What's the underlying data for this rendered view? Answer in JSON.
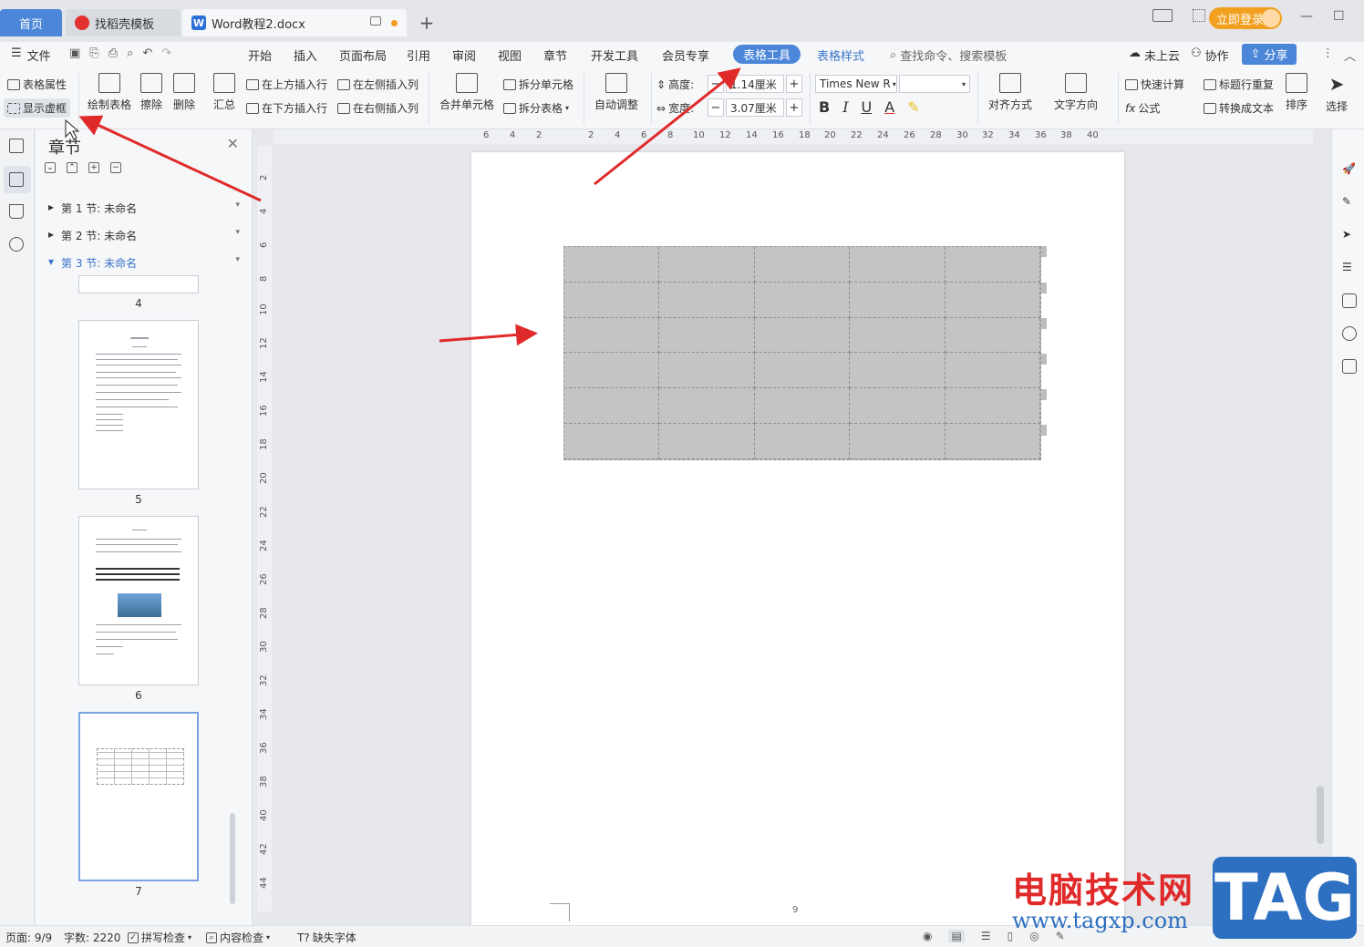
{
  "tabs": {
    "home": "首页",
    "daoke": "找稻壳模板",
    "doc": "Word教程2.docx"
  },
  "titlebar": {
    "login": "立即登录"
  },
  "menu": {
    "file": "文件",
    "items": [
      "开始",
      "插入",
      "页面布局",
      "引用",
      "审阅",
      "视图",
      "章节",
      "开发工具",
      "会员专享"
    ],
    "active": "表格工具",
    "table_style": "表格样式",
    "search": "查找命令、搜索模板",
    "cloud": "未上云",
    "collab": "协作",
    "share": "分享"
  },
  "ribbon": {
    "table_props": "表格属性",
    "show_grid": "显示虚框",
    "draw_table": "绘制表格",
    "erase": "擦除",
    "delete": "删除",
    "summary": "汇总",
    "insert_above": "在上方插入行",
    "insert_below": "在下方插入行",
    "insert_left": "在左侧插入列",
    "insert_right": "在右侧插入列",
    "merge_cells": "合并单元格",
    "split_cells": "拆分单元格",
    "split_table": "拆分表格",
    "auto_fit": "自动调整",
    "height_label": "高度:",
    "height_value": "1.14厘米",
    "width_label": "宽度:",
    "width_value": "3.07厘米",
    "font_name": "Times New R",
    "align": "对齐方式",
    "text_dir": "文字方向",
    "quick_calc": "快速计算",
    "formula": "公式",
    "header_repeat": "标题行重复",
    "to_text": "转换成文本",
    "sort": "排序",
    "select": "选择"
  },
  "chapter_panel": {
    "title": "章节",
    "sections": [
      "第 1 节: 未命名",
      "第 2 节: 未命名",
      "第 3 节: 未命名"
    ],
    "thumb_numbers": [
      "4",
      "5",
      "6",
      "7"
    ]
  },
  "hruler_labels": [
    "6",
    "4",
    "2",
    "2",
    "4",
    "6",
    "8",
    "10",
    "12",
    "14",
    "16",
    "18",
    "20",
    "22",
    "24",
    "26",
    "28",
    "30",
    "32",
    "34",
    "36",
    "38",
    "40"
  ],
  "vruler_labels": [
    "2",
    "4",
    "6",
    "8",
    "10",
    "12",
    "14",
    "16",
    "18",
    "20",
    "22",
    "24",
    "26",
    "28",
    "30",
    "32",
    "34",
    "36",
    "38",
    "40",
    "42",
    "44"
  ],
  "document": {
    "page_number": "9",
    "table_rows": 6,
    "table_cols": 5
  },
  "status": {
    "page": "页面: 9/9",
    "words": "字数: 2220",
    "spell": "拼写检查",
    "content": "内容检查",
    "missing_font": "缺失字体"
  },
  "watermark": {
    "text": "电脑技术网",
    "url": "www.tagxp.com",
    "tag": "TAG"
  },
  "colors": {
    "accent": "#4b86d8",
    "arrow": "#e02a2a",
    "table_fill": "#c4c4c4"
  }
}
